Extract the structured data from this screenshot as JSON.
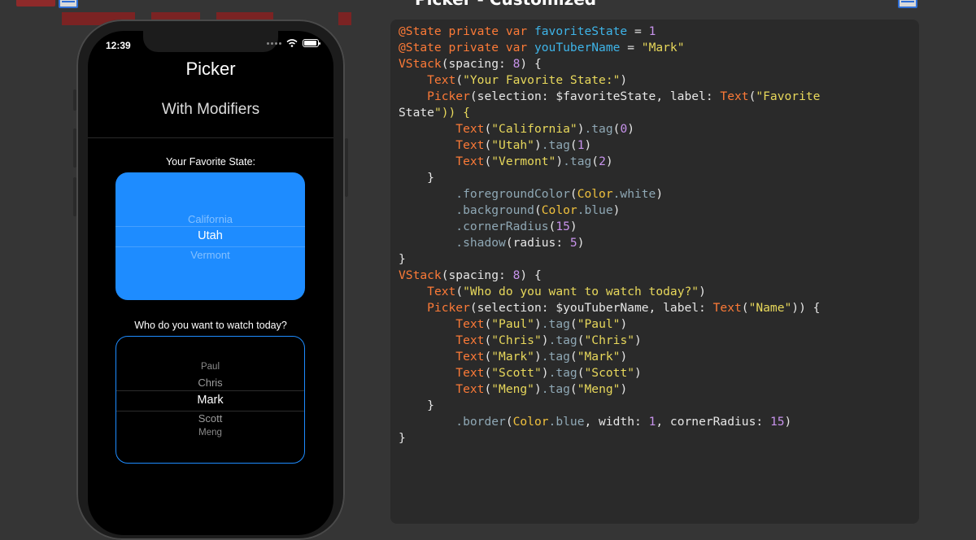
{
  "header": {
    "title": "Picker - Customized"
  },
  "colors": {
    "accent_blue": "#1e8cff",
    "background": "#353535",
    "code_bg": "#2a2a2a"
  },
  "phone": {
    "status_time": "12:39",
    "nav_title": "Picker",
    "nav_subtitle": "With Modifiers",
    "picker1": {
      "label": "Your Favorite State:",
      "options": [
        "California",
        "Utah",
        "Vermont"
      ],
      "selected": "Utah"
    },
    "picker2": {
      "label": "Who do you want to watch today?",
      "options": [
        "Paul",
        "Chris",
        "Mark",
        "Scott",
        "Meng"
      ],
      "selected": "Mark"
    }
  },
  "code_lines": [
    "@State private var favoriteState = 1",
    "@State private var youTuberName = \"Mark\"",
    "",
    "VStack(spacing: 8) {",
    "    Text(\"Your Favorite State:\")",
    "",
    "    Picker(selection: $favoriteState, label: Text(\"Favorite",
    "State\")) {",
    "        Text(\"California\").tag(0)",
    "        Text(\"Utah\").tag(1)",
    "        Text(\"Vermont\").tag(2)",
    "    }",
    "        .foregroundColor(Color.white)",
    "        .background(Color.blue)",
    "        .cornerRadius(15)",
    "        .shadow(radius: 5)",
    "}",
    "",
    "VStack(spacing: 8) {",
    "    Text(\"Who do you want to watch today?\")",
    "",
    "    Picker(selection: $youTuberName, label: Text(\"Name\")) {",
    "        Text(\"Paul\").tag(\"Paul\")",
    "        Text(\"Chris\").tag(\"Chris\")",
    "        Text(\"Mark\").tag(\"Mark\")",
    "        Text(\"Scott\").tag(\"Scott\")",
    "        Text(\"Meng\").tag(\"Meng\")",
    "    }",
    "        .border(Color.blue, width: 1, cornerRadius: 15)",
    "}"
  ]
}
